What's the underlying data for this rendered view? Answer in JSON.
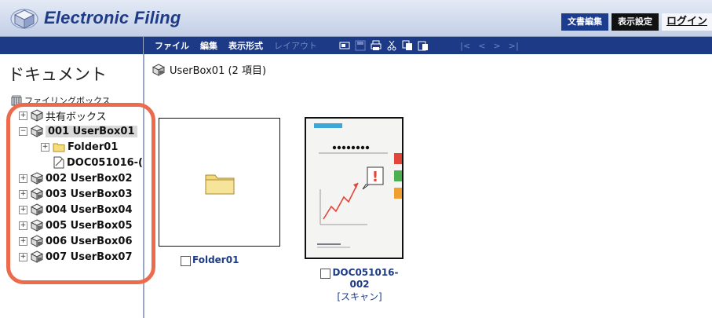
{
  "header": {
    "title": "Electronic Filing",
    "logo_icon": "cube-logo-icon",
    "buttons": [
      "文書編集",
      "表示設定"
    ],
    "login_label": "ログイン"
  },
  "toolbar": {
    "menus": [
      "ファイル",
      "編集",
      "表示形式",
      "レイアウト"
    ],
    "icons": [
      "scan-icon",
      "save-icon",
      "print-icon",
      "cut-icon",
      "copy-icon",
      "paste-icon"
    ],
    "nav": [
      "|<",
      "<",
      ">",
      ">|"
    ]
  },
  "sidebar": {
    "title": "ドキュメント",
    "root_label": "ファイリングボックス",
    "tree": [
      {
        "label": "共有ボックス",
        "expander": "+",
        "icon": "shared-box-icon",
        "selected": false
      },
      {
        "label": "001 UserBox01",
        "expander": "−",
        "icon": "user-box-icon",
        "selected": true
      },
      {
        "label": "Folder01",
        "expander": "+",
        "icon": "folder-icon",
        "selected": false
      },
      {
        "label": "DOC051016-(",
        "expander": "",
        "icon": "document-icon",
        "selected": false
      },
      {
        "label": "002 UserBox02",
        "expander": "+",
        "icon": "user-box-icon",
        "selected": false
      },
      {
        "label": "003 UserBox03",
        "expander": "+",
        "icon": "user-box-icon",
        "selected": false
      },
      {
        "label": "004 UserBox04",
        "expander": "+",
        "icon": "user-box-icon",
        "selected": false
      },
      {
        "label": "005 UserBox05",
        "expander": "+",
        "icon": "user-box-icon",
        "selected": false
      },
      {
        "label": "006 UserBox06",
        "expander": "+",
        "icon": "user-box-icon",
        "selected": false
      },
      {
        "label": "007 UserBox07",
        "expander": "+",
        "icon": "user-box-icon",
        "selected": false
      }
    ]
  },
  "main": {
    "breadcrumb": "UserBox01 (2 項目)",
    "items": [
      {
        "name": "Folder01",
        "kind": "folder"
      },
      {
        "name_line1": "DOC051016-",
        "name_line2": "002",
        "type_label": "[スキャン]",
        "kind": "document"
      }
    ]
  },
  "colors": {
    "brand": "#1d3b87",
    "toolbar": "#1c3a86",
    "highlight": "#ec6b4d"
  }
}
